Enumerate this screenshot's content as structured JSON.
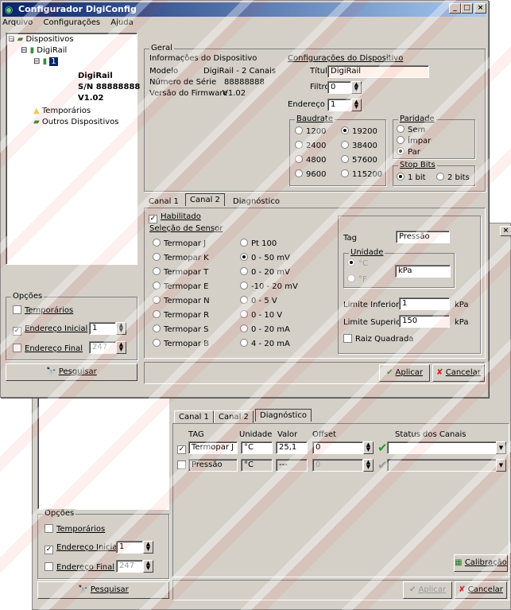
{
  "app": {
    "title": "Configurador DigiConfig"
  },
  "menu": [
    "Arquivo",
    "Configurações",
    "Ajuda"
  ],
  "tree": {
    "root": "Dispositivos",
    "digirail": "DigiRail",
    "node": "1",
    "name": "DigiRail",
    "serial": "S/N 88888888",
    "version": "V1.02",
    "temp": "Temporários",
    "others": "Outros Dispositivos"
  },
  "options": {
    "title": "Opções",
    "temporarios": "Temporários",
    "endereco_inicial": "Endereço Inicial",
    "endereco_inicial_value": "1",
    "endereco_final": "Endereço Final",
    "endereco_final_value": "247",
    "search": "Pesquisar"
  },
  "geral": {
    "title": "Geral",
    "info_title": "Informações do Dispositivo",
    "modelo_label": "Modelo",
    "modelo_value": "DigiRail - 2 Canais",
    "serie_label": "Número de Série",
    "serie_value": "88888888",
    "firmware_label": "Versão do Firmware",
    "firmware_value": "V1.02",
    "config_title": "Configurações do Dispositivo",
    "titulo_label": "Título",
    "titulo_value": "DigiRail",
    "filtro_label": "Filtro",
    "filtro_value": "0",
    "endereco_label": "Endereço",
    "endereco_value": "1"
  },
  "baudrate": {
    "title": "Baudrate",
    "options": [
      "1200",
      "19200",
      "2400",
      "38400",
      "4800",
      "57600",
      "9600",
      "115200"
    ],
    "selected": "19200"
  },
  "paridade": {
    "title": "Paridade",
    "options": [
      "Sem",
      "Ímpar",
      "Par"
    ],
    "selected": "Par"
  },
  "stopbits": {
    "title": "Stop Bits",
    "options": [
      "1 bit",
      "2 bits"
    ],
    "selected": "1 bit"
  },
  "tabs": [
    "Canal 1",
    "Canal 2",
    "Diagnóstico"
  ],
  "canal": {
    "habilitado": "Habilitado",
    "sensor_title": "Seleção de Sensor",
    "sensors_left": [
      "Termopar J",
      "Termopar K",
      "Termopar T",
      "Termopar E",
      "Termopar N",
      "Termopar R",
      "Termopar S",
      "Termopar B"
    ],
    "sensors_right": [
      "Pt 100",
      "0 - 50 mV",
      "0 - 20 mV",
      "-10 - 20 mV",
      "0 - 5 V",
      "0 - 10 V",
      "0 - 20 mA",
      "4 - 20 mA"
    ],
    "selected": "0 - 50 mV",
    "tag_label": "Tag",
    "tag_value": "Pressão",
    "unidade_title": "Unidade",
    "unit_c": "°C",
    "unit_f": "°F",
    "unit_value": "kPa",
    "lim_inf_label": "Limite Inferior",
    "lim_inf_value": "1",
    "lim_sup_label": "Limite Superior",
    "lim_sup_value": "150",
    "unit_suffix": "kPa",
    "raiz": "Raiz Quadrada"
  },
  "buttons": {
    "aplicar": "Aplicar",
    "cancelar": "Cancelar",
    "calibracao": "Calibração"
  },
  "diag": {
    "headers": [
      "TAG",
      "Unidade",
      "Valor",
      "Offset",
      "Status dos Canais"
    ],
    "rows": [
      {
        "tag": "Termopar J",
        "unidade": "°C",
        "valor": "25,1",
        "offset": "0"
      },
      {
        "tag": "Pressão",
        "unidade": "°C",
        "valor": "---",
        "offset": "0"
      }
    ]
  },
  "colors": {
    "titlebar": "#0a246a",
    "face": "#d4d0c8"
  }
}
